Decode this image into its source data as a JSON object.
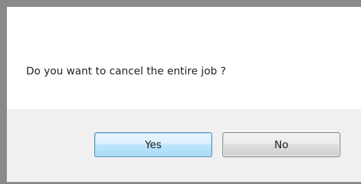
{
  "dialog": {
    "message": "Do you want to cancel the entire job ?",
    "buttons": {
      "yes_label": "Yes",
      "no_label": "No"
    }
  },
  "colors": {
    "frame": "#8a8a8a",
    "content_background": "#ffffff",
    "button_bar_background": "#f0f0f0",
    "default_button_border": "#3c7fb1",
    "default_button_fill": "#bee6fd",
    "button_border": "#707070",
    "text": "#1e1e1e"
  }
}
